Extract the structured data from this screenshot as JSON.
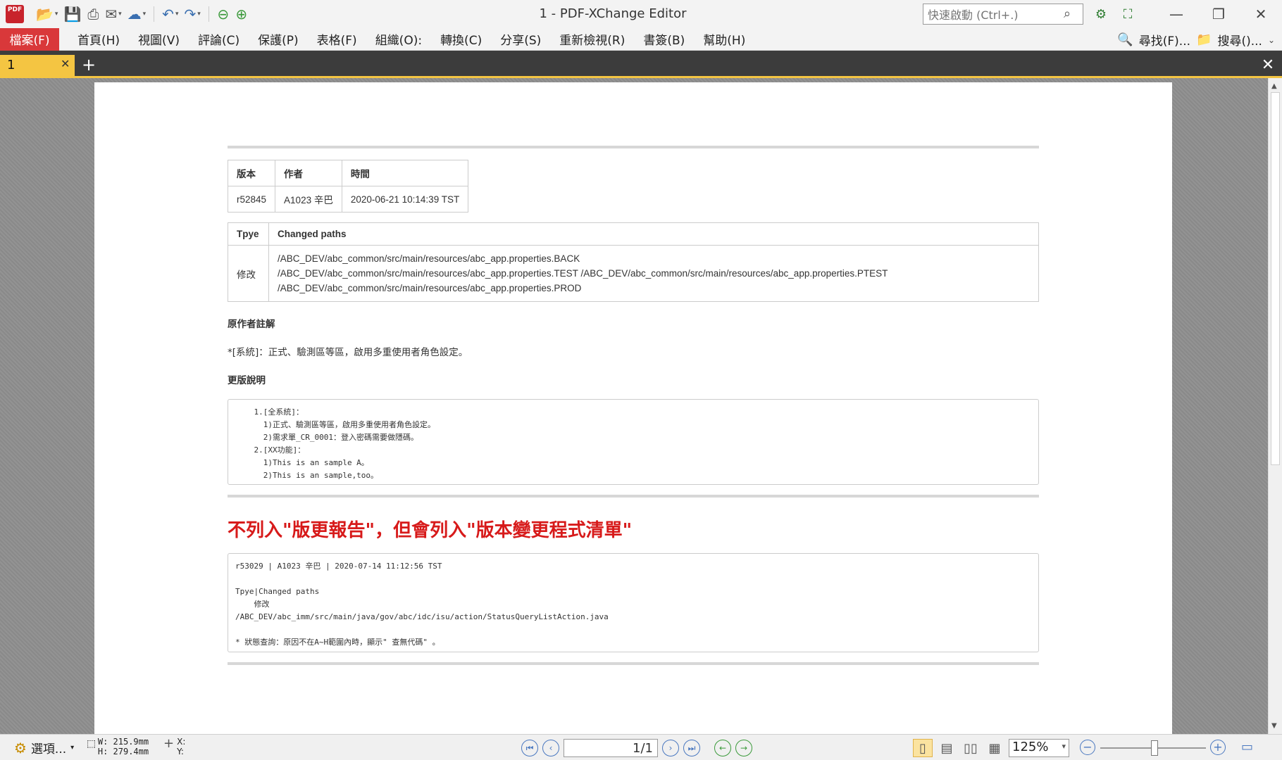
{
  "window": {
    "title": "1 - PDF-XChange Editor",
    "logo_text": "PDF",
    "quick_launch_placeholder": "快速啟動 (Ctrl+.)"
  },
  "menu": {
    "file": "檔案(F)",
    "items": [
      "首頁(H)",
      "視圖(V)",
      "評論(C)",
      "保護(P)",
      "表格(F)",
      "組織(O):",
      "轉換(C)",
      "分享(S)",
      "重新檢視(R)",
      "書簽(B)",
      "幫助(H)"
    ],
    "find": "尋找(F)...",
    "search": "搜尋()..."
  },
  "tabs": {
    "active_label": "1"
  },
  "document": {
    "rev_headers": [
      "版本",
      "作者",
      "時間"
    ],
    "rev_row": [
      "r52845",
      "A1023 辛巴",
      "2020-06-21 10:14:39 TST"
    ],
    "paths_headers": [
      "Tpye",
      "Changed paths"
    ],
    "paths_type": "修改",
    "paths": [
      "/ABC_DEV/abc_common/src/main/resources/abc_app.properties.BACK",
      "/ABC_DEV/abc_common/src/main/resources/abc_app.properties.TEST /ABC_DEV/abc_common/src/main/resources/abc_app.properties.PTEST",
      "/ABC_DEV/abc_common/src/main/resources/abc_app.properties.PROD"
    ],
    "author_note_title": "原作者註解",
    "author_note": "*[系統]：正式、驗測區等區，啟用多重使用者角色設定。",
    "changelog_title": "更版說明",
    "changelog_lines": [
      "    1.[全系統]：",
      "      1)正式、驗測區等區，啟用多重使用者角色設定。",
      "      2)需求單_CR_0001：登入密碼需要做隱碼。",
      "    2.[XX功能]：",
      "      1)This is an sample A。",
      "      2)This is an sample,too。"
    ],
    "red_heading": "不列入\"版更報告\"，但會列入\"版本變更程式清單\"",
    "log_lines": [
      "r53029 | A1023 辛巴 | 2020-07-14 11:12:56 TST",
      "",
      "Tpye|Changed paths",
      "    修改",
      "/ABC_DEV/abc_imm/src/main/java/gov/abc/idc/isu/action/StatusQueryListAction.java",
      "",
      "* 狀態查詢：原因不在A~H範圍內時，顯示\" 查無代碼\" 。"
    ]
  },
  "status": {
    "options": "選項...",
    "width": "W: 215.9mm",
    "height": "H: 279.4mm",
    "x": "X:",
    "y": "Y:",
    "page_indicator": "1/1",
    "zoom": "125%"
  }
}
